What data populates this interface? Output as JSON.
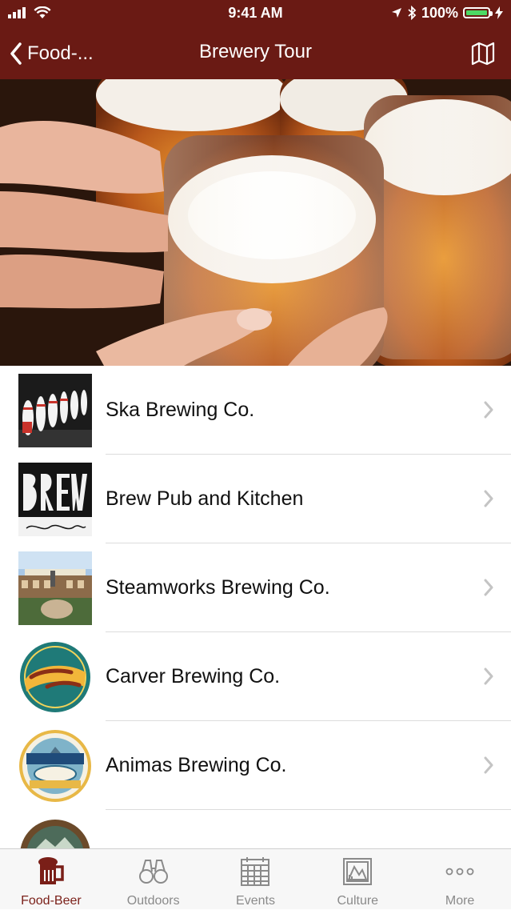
{
  "status_bar": {
    "time": "9:41 AM",
    "battery": "100%"
  },
  "nav": {
    "back_label": "Food-...",
    "title": "Brewery Tour"
  },
  "breweries": [
    {
      "name": "Ska Brewing Co."
    },
    {
      "name": "Brew Pub and Kitchen"
    },
    {
      "name": "Steamworks Brewing Co."
    },
    {
      "name": "Carver Brewing Co."
    },
    {
      "name": "Animas Brewing Co."
    },
    {
      "name": ""
    }
  ],
  "tabs": [
    {
      "label": "Food-Beer",
      "icon": "beer-mug-icon",
      "active": true
    },
    {
      "label": "Outdoors",
      "icon": "binoculars-icon",
      "active": false
    },
    {
      "label": "Events",
      "icon": "calendar-icon",
      "active": false
    },
    {
      "label": "Culture",
      "icon": "gallery-icon",
      "active": false
    },
    {
      "label": "More",
      "icon": "more-dots-icon",
      "active": false
    }
  ],
  "colors": {
    "nav_bg": "#6a1a14",
    "active_tab": "#7a1f18",
    "inactive_tab": "#8a8a8a",
    "battery": "#4cd964"
  }
}
